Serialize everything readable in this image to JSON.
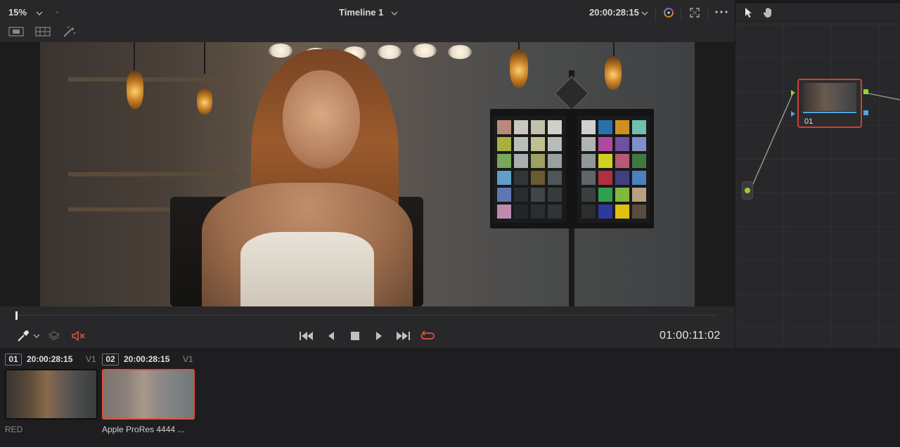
{
  "viewer": {
    "zoom": "15%",
    "timeline_title": "Timeline 1",
    "timecode_top": "20:00:28:15",
    "timecode_bottom": "01:00:11:02"
  },
  "nodes": {
    "node_label": "01"
  },
  "clips": [
    {
      "number": "01",
      "timecode": "20:00:28:15",
      "track": "V1",
      "name": "RED",
      "selected": false
    },
    {
      "number": "02",
      "timecode": "20:00:28:15",
      "track": "V1",
      "name": "Apple ProRes 4444 ...",
      "selected": true
    }
  ],
  "colors": {
    "accent_red": "#e0503a",
    "node_input_green": "#9ad030",
    "node_output_blue": "#4aa8e0",
    "mute_icon": "#e0503a",
    "loop_icon": "#e0503a"
  },
  "icons": {
    "zoom_dropdown": "chevron-down-icon",
    "color_wheel": "color-wheel-icon",
    "fullscreen": "fullscreen-icon",
    "more": "more-options-icon",
    "pointer": "pointer-icon",
    "hand": "hand-icon",
    "picker": "eyedropper-icon",
    "layers": "layers-icon",
    "mute": "speaker-muted-icon",
    "first_frame": "skip-to-start-icon",
    "prev_frame": "play-reverse-icon",
    "stop": "stop-icon",
    "play": "play-icon",
    "last_frame": "skip-to-end-icon",
    "loop": "loop-icon"
  }
}
